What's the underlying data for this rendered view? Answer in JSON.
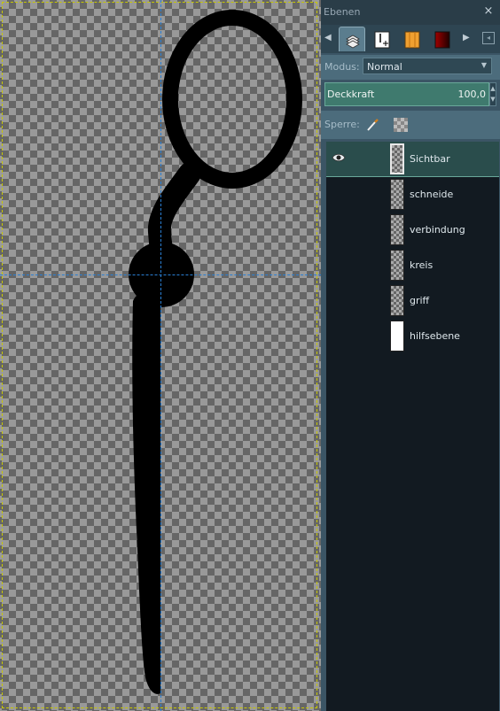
{
  "dock": {
    "title": "Ebenen",
    "close_icon": "×",
    "mode_label": "Modus:",
    "mode_value": "Normal",
    "opacity_label": "Deckkraft",
    "opacity_value": "100,0",
    "lock_label": "Sperre:"
  },
  "tabs": [
    {
      "name": "layers-icon"
    },
    {
      "name": "channels-icon"
    },
    {
      "name": "paths-icon"
    },
    {
      "name": "gradient-icon"
    }
  ],
  "layers": [
    {
      "name": "Sichtbar",
      "visible": true,
      "selected": true
    },
    {
      "name": "schneide",
      "visible": false,
      "selected": false
    },
    {
      "name": "verbindung",
      "visible": false,
      "selected": false
    },
    {
      "name": "kreis",
      "visible": false,
      "selected": false
    },
    {
      "name": "griff",
      "visible": false,
      "selected": false
    },
    {
      "name": "hilfsebene",
      "visible": false,
      "selected": false
    }
  ],
  "colors": {
    "dock_bg": "#3b5565",
    "selection": "#2a4d4c",
    "guide": "#2a7fd4",
    "shape": "#000000"
  }
}
